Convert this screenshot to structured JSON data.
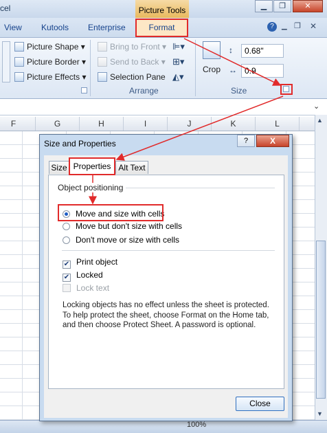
{
  "window": {
    "app_title_fragment": "cel",
    "context_tab_group": "Picture Tools",
    "min_label": "▁",
    "restore_label": "❐",
    "close_label": "✕"
  },
  "tabs": [
    "View",
    "Kutools",
    "Enterprise",
    "Format"
  ],
  "ribbon": {
    "help_label": "?",
    "picture_styles": [
      "Picture Shape",
      "Picture Border",
      "Picture Effects"
    ],
    "arrange": [
      "Bring to Front",
      "Send to Back",
      "Selection Pane"
    ],
    "arrange_label": "Arrange",
    "crop_label": "Crop",
    "size_label": "Size",
    "height_value": "0.68\"",
    "width_value": "0.9"
  },
  "sheet": {
    "columns": [
      "F",
      "G",
      "H",
      "I",
      "J",
      "K",
      "L"
    ],
    "zoom_fragment": "100%"
  },
  "dialog": {
    "title": "Size and Properties",
    "help_label": "?",
    "close_label": "X",
    "tabs": [
      "Size",
      "Properties",
      "Alt Text"
    ],
    "active_tab": "Properties",
    "section_label": "Object positioning",
    "radios": [
      {
        "label": "Move and size with cells",
        "checked": true
      },
      {
        "label": "Move but don't size with cells",
        "checked": false
      },
      {
        "label": "Don't move or size with cells",
        "checked": false
      }
    ],
    "checks": [
      {
        "label": "Print object",
        "checked": true,
        "disabled": false
      },
      {
        "label": "Locked",
        "checked": true,
        "disabled": false
      },
      {
        "label": "Lock text",
        "checked": false,
        "disabled": true
      }
    ],
    "info_text": "Locking objects has no effect unless the sheet is protected. To help protect the sheet, choose Format on the Home tab, and then choose Protect Sheet. A password is optional.",
    "close_button": "Close"
  },
  "colors": {
    "annotation_red": "#e12a2a",
    "accent_blue": "#15428b"
  }
}
